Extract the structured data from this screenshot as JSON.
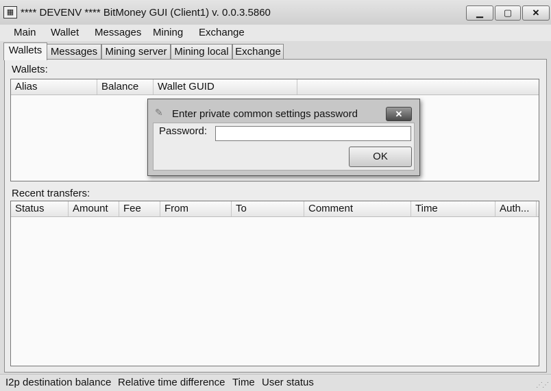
{
  "window": {
    "title": "**** DEVENV **** BitMoney GUI (Client1) v. 0.0.3.5860",
    "controls": {
      "minimize": "▁",
      "maximize": "▢",
      "close": "✕"
    }
  },
  "menu": [
    "Main",
    "Wallet",
    "Messages",
    "Mining",
    "Exchange"
  ],
  "tabs": [
    "Wallets",
    "Messages",
    "Mining server",
    "Mining local",
    "Exchange"
  ],
  "wallets": {
    "label": "Wallets:",
    "columns": [
      "Alias",
      "Balance",
      "Wallet GUID"
    ]
  },
  "transfers": {
    "label": "Recent transfers:",
    "columns": [
      "Status",
      "Amount",
      "Fee",
      "From",
      "To",
      "Comment",
      "Time",
      "Auth..."
    ]
  },
  "dialog": {
    "title": "Enter private common settings password",
    "close": "✕",
    "password_label": "Password:",
    "password_value": "",
    "ok_label": "OK"
  },
  "statusbar": [
    "I2p destination balance",
    "Relative time difference",
    "Time",
    "User status"
  ]
}
